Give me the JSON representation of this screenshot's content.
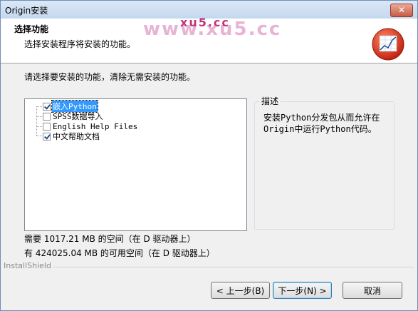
{
  "window": {
    "title": "Origin安装",
    "close_label": "✕"
  },
  "header": {
    "title": "选择功能",
    "subtitle": "选择安装程序将安装的功能。",
    "watermark_small": "xu5.cc",
    "watermark_big": "www.xu5.cc"
  },
  "instruction": "请选择要安装的功能，清除无需安装的功能。",
  "features": [
    {
      "label": "嵌入Python",
      "checked": true,
      "selected": true
    },
    {
      "label": "SPSS数据导入",
      "checked": false,
      "selected": false
    },
    {
      "label": "English Help Files",
      "checked": false,
      "selected": false
    },
    {
      "label": "中文帮助文档",
      "checked": true,
      "selected": false
    }
  ],
  "description": {
    "legend": "描述",
    "text": "安装Python分发包从而允许在Origin中运行Python代码。"
  },
  "space": {
    "required": "需要 1017.21 MB 的空间（在 D 驱动器上）",
    "available": "有 424025.04 MB 的可用空间（在 D 驱动器上）"
  },
  "footer_brand": "InstallShield",
  "buttons": {
    "back": "< 上一步(B)",
    "next": "下一步(N) >",
    "cancel": "取消"
  },
  "colors": {
    "selection": "#3399ff",
    "watermark": "#c3337a"
  }
}
